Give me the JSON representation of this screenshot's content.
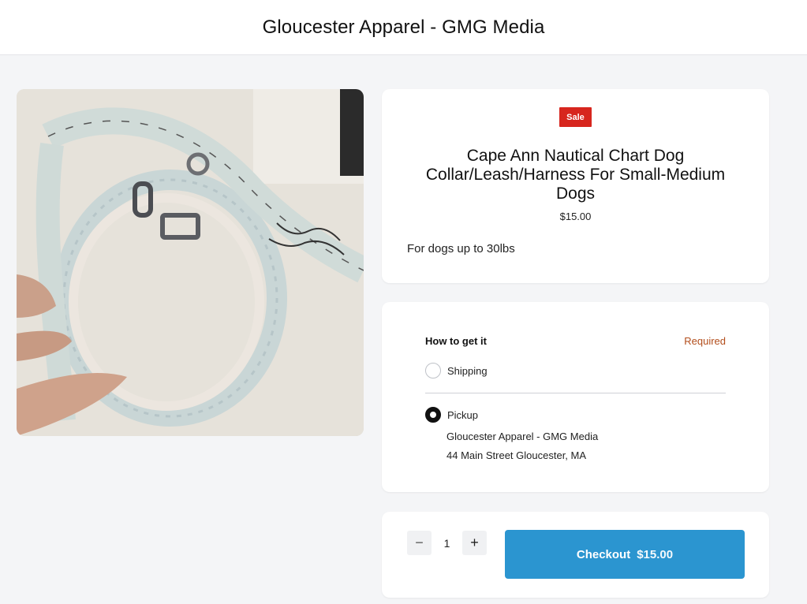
{
  "header": {
    "title": "Gloucester Apparel - GMG Media"
  },
  "product": {
    "badge": "Sale",
    "name": "Cape Ann Nautical Chart Dog Collar/Leash/Harness For Small-Medium Dogs",
    "price": "$15.00",
    "description": "For dogs up to 30lbs",
    "image_alt": "Nautical chart patterned dog leash"
  },
  "fulfillment": {
    "heading": "How to get it",
    "required_label": "Required",
    "options": [
      {
        "label": "Shipping",
        "selected": false
      },
      {
        "label": "Pickup",
        "selected": true
      }
    ],
    "pickup_name": "Gloucester Apparel - GMG Media",
    "pickup_address": "44 Main Street Gloucester, MA"
  },
  "purchase": {
    "quantity": "1",
    "decrement_icon": "minus-icon",
    "increment_icon": "plus-icon",
    "checkout_label": "Checkout",
    "checkout_amount": "$15.00"
  },
  "colors": {
    "sale_badge": "#d7261e",
    "checkout_button": "#2b95d0",
    "required_text": "#b24d1b",
    "page_background": "#f4f5f7"
  }
}
